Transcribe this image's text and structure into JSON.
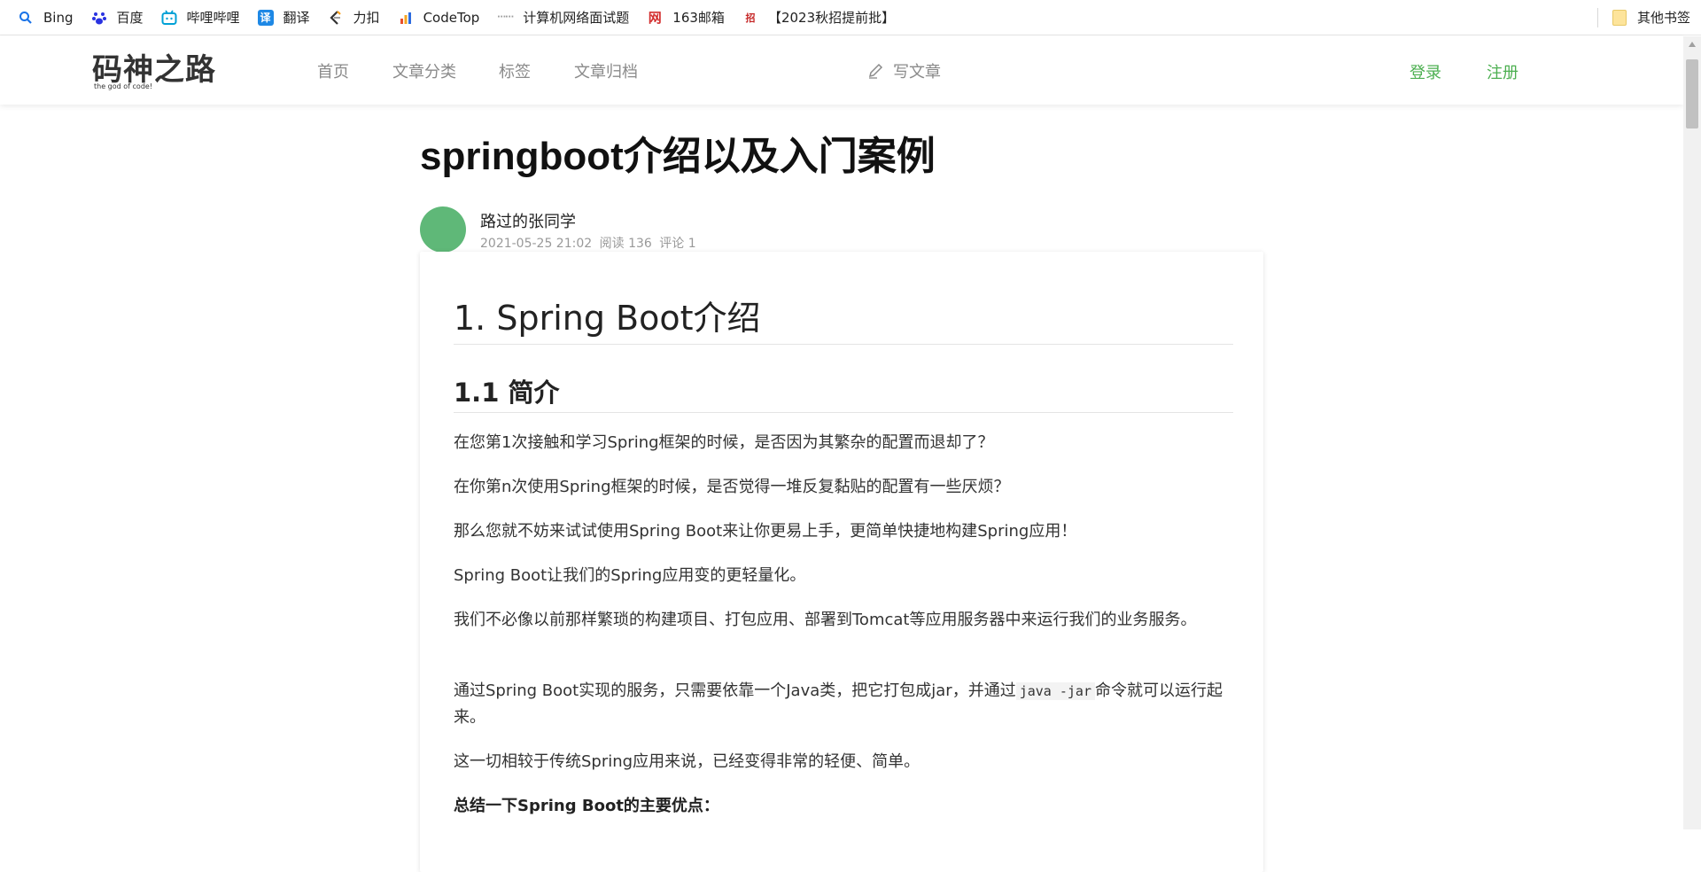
{
  "bookmarks": {
    "items": [
      {
        "label": "Bing",
        "icon": "search-icon",
        "color": "#1a73e8"
      },
      {
        "label": "百度",
        "icon": "paw-icon",
        "color": "#2932e1"
      },
      {
        "label": "哔哩哔哩",
        "icon": "tv-icon",
        "color": "#00a1d6"
      },
      {
        "label": "翻译",
        "icon": "translate-icon",
        "color": "#1e88e5"
      },
      {
        "label": "力扣",
        "icon": "leetcode-icon",
        "color": "#f89f1b"
      },
      {
        "label": "CodeTop",
        "icon": "chart-bars-icon",
        "color": "#e94f2b"
      },
      {
        "label": "计算机网络面试题",
        "icon": "dots-icon",
        "color": "#9e9e9e"
      },
      {
        "label": "163邮箱",
        "icon": "mail-icon",
        "color": "#d32f2f"
      },
      {
        "label": "【2023秋招提前批】",
        "icon": "calendar-icon",
        "color": "#c62828"
      }
    ],
    "other_label": "其他书签"
  },
  "header": {
    "logo_text": "码神之路",
    "logo_sub": "the god of code!",
    "nav": [
      "首页",
      "文章分类",
      "标签",
      "文章归档"
    ],
    "write_label": "写文章",
    "login_label": "登录",
    "register_label": "注册",
    "accent": "#4caf50"
  },
  "article": {
    "title": "springboot介绍以及入门案例",
    "author": "路过的张同学",
    "date": "2021-05-25 21:02",
    "reads": "阅读 136",
    "comments": "评论 1",
    "avatar_color": "#5fb878",
    "h1": "1. Spring Boot介绍",
    "h2": "1.1 简介",
    "paragraphs": [
      "在您第1次接触和学习Spring框架的时候，是否因为其繁杂的配置而退却了？",
      "在你第n次使用Spring框架的时候，是否觉得一堆反复黏贴的配置有一些厌烦？",
      "那么您就不妨来试试使用Spring Boot来让你更易上手，更简单快捷地构建Spring应用！",
      "Spring Boot让我们的Spring应用变的更轻量化。",
      "我们不必像以前那样繁琐的构建项目、打包应用、部署到Tomcat等应用服务器中来运行我们的业务服务。"
    ],
    "p6_before": "通过Spring Boot实现的服务，只需要依靠一个Java类，把它打包成jar，并通过",
    "p6_code": "java -jar",
    "p6_after": "命令就可以运行起来。",
    "p7": "这一切相较于传统Spring应用来说，已经变得非常的轻便、简单。",
    "summary": "总结一下Spring Boot的主要优点："
  }
}
